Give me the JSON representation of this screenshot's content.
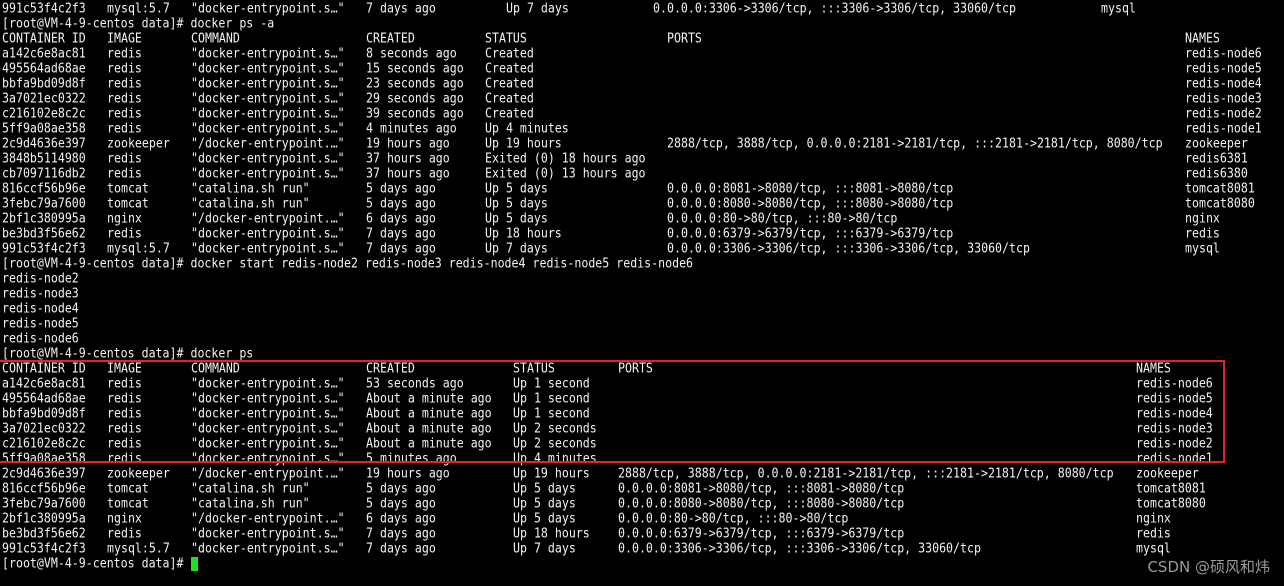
{
  "terminal": {
    "prev_row": [
      "991c53f4c2f3",
      "mysql:5.7",
      "\"docker-entrypoint.s…\"",
      "7 days ago",
      "Up 7 days",
      "0.0.0.0:3306->3306/tcp, :::3306->3306/tcp, 33060/tcp",
      "mysql"
    ],
    "prompt1": "[root@VM-4-9-centos data]# docker ps -a",
    "table1": {
      "header": [
        "CONTAINER ID",
        "IMAGE",
        "COMMAND",
        "CREATED",
        "STATUS",
        "PORTS",
        "NAMES"
      ],
      "rows": [
        [
          "a142c6e8ac81",
          "redis",
          "\"docker-entrypoint.s…\"",
          "8 seconds ago",
          "Created",
          "",
          "redis-node6"
        ],
        [
          "495564ad68ae",
          "redis",
          "\"docker-entrypoint.s…\"",
          "15 seconds ago",
          "Created",
          "",
          "redis-node5"
        ],
        [
          "bbfa9bd09d8f",
          "redis",
          "\"docker-entrypoint.s…\"",
          "23 seconds ago",
          "Created",
          "",
          "redis-node4"
        ],
        [
          "3a7021ec0322",
          "redis",
          "\"docker-entrypoint.s…\"",
          "29 seconds ago",
          "Created",
          "",
          "redis-node3"
        ],
        [
          "c216102e8c2c",
          "redis",
          "\"docker-entrypoint.s…\"",
          "39 seconds ago",
          "Created",
          "",
          "redis-node2"
        ],
        [
          "5ff9a08ae358",
          "redis",
          "\"docker-entrypoint.s…\"",
          "4 minutes ago",
          "Up 4 minutes",
          "",
          "redis-node1"
        ],
        [
          "2c9d4636e397",
          "zookeeper",
          "\"/docker-entrypoint.…\"",
          "19 hours ago",
          "Up 19 hours",
          "2888/tcp, 3888/tcp, 0.0.0.0:2181->2181/tcp, :::2181->2181/tcp, 8080/tcp",
          "zookeeper"
        ],
        [
          "3848b5114980",
          "redis",
          "\"docker-entrypoint.s…\"",
          "37 hours ago",
          "Exited (0) 18 hours ago",
          "",
          "redis6381"
        ],
        [
          "cb7097116db2",
          "redis",
          "\"docker-entrypoint.s…\"",
          "37 hours ago",
          "Exited (0) 13 hours ago",
          "",
          "redis6380"
        ],
        [
          "816ccf56b96e",
          "tomcat",
          "\"catalina.sh run\"",
          "5 days ago",
          "Up 5 days",
          "0.0.0.0:8081->8080/tcp, :::8081->8080/tcp",
          "tomcat8081"
        ],
        [
          "3febc79a7600",
          "tomcat",
          "\"catalina.sh run\"",
          "5 days ago",
          "Up 5 days",
          "0.0.0.0:8080->8080/tcp, :::8080->8080/tcp",
          "tomcat8080"
        ],
        [
          "2bf1c380995a",
          "nginx",
          "\"/docker-entrypoint.…\"",
          "6 days ago",
          "Up 5 days",
          "0.0.0.0:80->80/tcp, :::80->80/tcp",
          "nginx"
        ],
        [
          "be3bd3f56e62",
          "redis",
          "\"docker-entrypoint.s…\"",
          "7 days ago",
          "Up 18 hours",
          "0.0.0.0:6379->6379/tcp, :::6379->6379/tcp",
          "redis"
        ],
        [
          "991c53f4c2f3",
          "mysql:5.7",
          "\"docker-entrypoint.s…\"",
          "7 days ago",
          "Up 7 days",
          "0.0.0.0:3306->3306/tcp, :::3306->3306/tcp, 33060/tcp",
          "mysql"
        ]
      ]
    },
    "prompt2": "[root@VM-4-9-centos data]# docker start redis-node2 redis-node3 redis-node4 redis-node5 redis-node6",
    "start_output": [
      "redis-node2",
      "redis-node3",
      "redis-node4",
      "redis-node5",
      "redis-node6"
    ],
    "prompt3": "[root@VM-4-9-centos data]# docker ps",
    "table2": {
      "header": [
        "CONTAINER ID",
        "IMAGE",
        "COMMAND",
        "CREATED",
        "STATUS",
        "PORTS",
        "NAMES"
      ],
      "rows": [
        [
          "a142c6e8ac81",
          "redis",
          "\"docker-entrypoint.s…\"",
          "53 seconds ago",
          "Up 1 second",
          "",
          "redis-node6"
        ],
        [
          "495564ad68ae",
          "redis",
          "\"docker-entrypoint.s…\"",
          "About a minute ago",
          "Up 1 second",
          "",
          "redis-node5"
        ],
        [
          "bbfa9bd09d8f",
          "redis",
          "\"docker-entrypoint.s…\"",
          "About a minute ago",
          "Up 1 second",
          "",
          "redis-node4"
        ],
        [
          "3a7021ec0322",
          "redis",
          "\"docker-entrypoint.s…\"",
          "About a minute ago",
          "Up 2 seconds",
          "",
          "redis-node3"
        ],
        [
          "c216102e8c2c",
          "redis",
          "\"docker-entrypoint.s…\"",
          "About a minute ago",
          "Up 2 seconds",
          "",
          "redis-node2"
        ],
        [
          "5ff9a08ae358",
          "redis",
          "\"docker-entrypoint.s…\"",
          "5 minutes ago",
          "Up 4 minutes",
          "",
          "redis-node1"
        ],
        [
          "2c9d4636e397",
          "zookeeper",
          "\"/docker-entrypoint.…\"",
          "19 hours ago",
          "Up 19 hours",
          "2888/tcp, 3888/tcp, 0.0.0.0:2181->2181/tcp, :::2181->2181/tcp, 8080/tcp",
          "zookeeper"
        ],
        [
          "816ccf56b96e",
          "tomcat",
          "\"catalina.sh run\"",
          "5 days ago",
          "Up 5 days",
          "0.0.0.0:8081->8080/tcp, :::8081->8080/tcp",
          "tomcat8081"
        ],
        [
          "3febc79a7600",
          "tomcat",
          "\"catalina.sh run\"",
          "5 days ago",
          "Up 5 days",
          "0.0.0.0:8080->8080/tcp, :::8080->8080/tcp",
          "tomcat8080"
        ],
        [
          "2bf1c380995a",
          "nginx",
          "\"/docker-entrypoint.…\"",
          "6 days ago",
          "Up 5 days",
          "0.0.0.0:80->80/tcp, :::80->80/tcp",
          "nginx"
        ],
        [
          "be3bd3f56e62",
          "redis",
          "\"docker-entrypoint.s…\"",
          "7 days ago",
          "Up 18 hours",
          "0.0.0.0:6379->6379/tcp, :::6379->6379/tcp",
          "redis"
        ],
        [
          "991c53f4c2f3",
          "mysql:5.7",
          "\"docker-entrypoint.s…\"",
          "7 days ago",
          "Up 7 days",
          "0.0.0.0:3306->3306/tcp, :::3306->3306/tcp, 33060/tcp",
          "mysql"
        ]
      ]
    },
    "prompt4": "[root@VM-4-9-centos data]# ",
    "highlight_color": "#e8202a",
    "cursor_color": "#1ee01e"
  },
  "watermark": "CSDN @硕风和炜"
}
